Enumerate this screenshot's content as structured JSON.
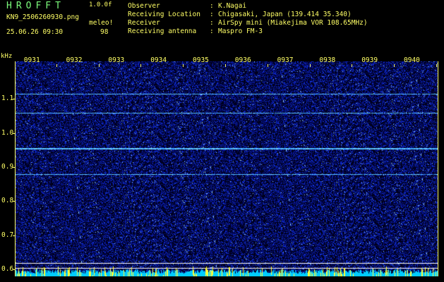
{
  "header": {
    "app_title": "HROFFT",
    "version": "1.0.0f",
    "filename": "KN9_2506260930.png",
    "datetime": "25.06.26 09:30",
    "meleo_label": "meleo!",
    "meleo_value": "98"
  },
  "metadata": [
    {
      "label": "Observer",
      "value": "K.Nagai"
    },
    {
      "label": "Receiving Location",
      "value": "Chigasaki, Japan (139.414 35.340)"
    },
    {
      "label": "Receiver",
      "value": "AirSpy mini (Miakejima VOR 108.65MHz)"
    },
    {
      "label": "Receiving antenna",
      "value": "Maspro FM-3"
    }
  ],
  "separator": ":",
  "chart_data": {
    "type": "heatmap",
    "ylabel": "kHz",
    "y_ticks": [
      "1.1",
      "1.0",
      "0.9",
      "0.8",
      "0.7",
      "0.6"
    ],
    "x_ticks": [
      "0931",
      "0932",
      "0933",
      "0934",
      "0935",
      "0936",
      "0937",
      "0938",
      "0939",
      "0940"
    ],
    "ylim": [
      0.58,
      1.21
    ],
    "x_range_minutes": [
      930,
      940
    ],
    "signal_lines_khz": [
      {
        "freq": 1.115,
        "strength": 0.7
      },
      {
        "freq": 1.06,
        "strength": 0.6
      },
      {
        "freq": 0.955,
        "strength": 1.0
      },
      {
        "freq": 0.88,
        "strength": 0.55
      }
    ],
    "marker_lines_khz": [
      0.62,
      0.605
    ],
    "colors": {
      "background": "#00001e",
      "noise": "#1a3cff",
      "signal": "#6fd4ff",
      "marker": "#ffffff",
      "axis": "#ffff66",
      "title": "#7cfc7c",
      "bottom_band": "#00ccff"
    }
  }
}
